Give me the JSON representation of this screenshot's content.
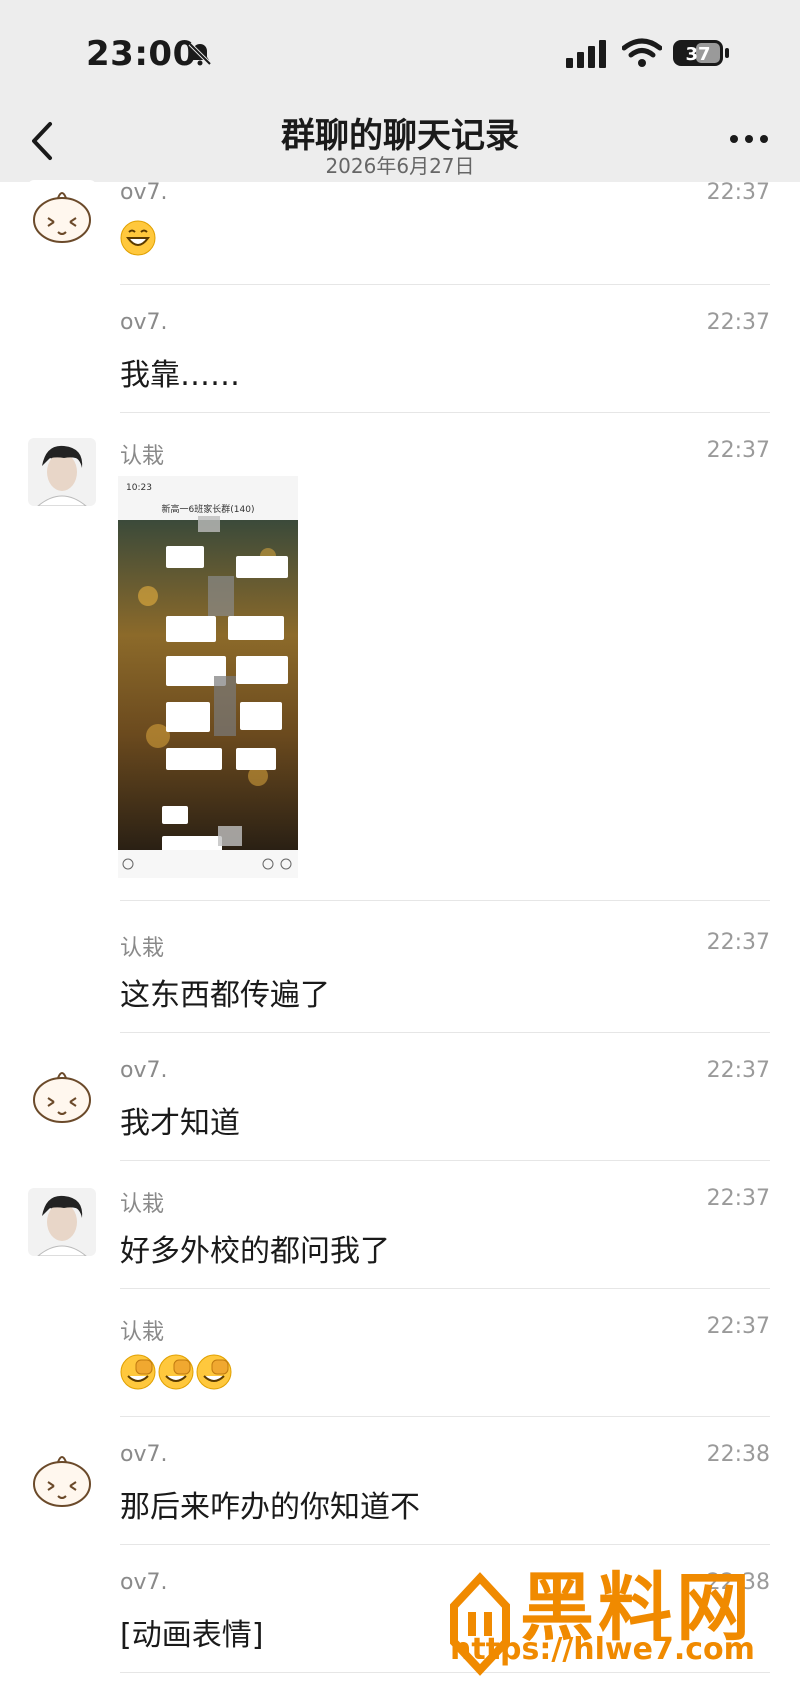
{
  "status": {
    "time": "23:00",
    "battery": "37"
  },
  "nav": {
    "title": "群聊的聊天记录",
    "date": "2026年6月27日"
  },
  "messages": [
    {
      "sender": "ov7.",
      "time": "22:37",
      "content": ""
    },
    {
      "sender": "ov7.",
      "time": "22:37",
      "content": "我靠……"
    },
    {
      "sender": "认栽",
      "time": "22:37",
      "content": ""
    },
    {
      "sender": "认栽",
      "time": "22:37",
      "content": "这东西都传遍了"
    },
    {
      "sender": "ov7.",
      "time": "22:37",
      "content": "我才知道"
    },
    {
      "sender": "认栽",
      "time": "22:37",
      "content": "好多外校的都问我了"
    },
    {
      "sender": "认栽",
      "time": "22:37",
      "content": ""
    },
    {
      "sender": "ov7.",
      "time": "22:38",
      "content": "那后来咋办的你知道不"
    },
    {
      "sender": "ov7.",
      "time": "22:38",
      "content": "[动画表情]"
    }
  ],
  "shared_image": {
    "title": "新高一6班家长群(140)",
    "time": "10:23"
  },
  "watermark": {
    "brand": "黑料网",
    "url": "https://hlwe7.com"
  },
  "colors": {
    "topbar": "#ededed",
    "watermark": "#f08a00"
  }
}
